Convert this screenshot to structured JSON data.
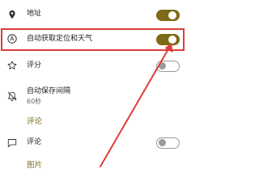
{
  "settings": {
    "address": {
      "label": "地址",
      "icon": "location-pin-icon",
      "enabled": true
    },
    "auto_location_weather": {
      "label": "自动获取定位和天气",
      "icon": "circle-a-icon",
      "enabled": true
    },
    "rating": {
      "label": "评分",
      "icon": "star-icon",
      "enabled": false
    },
    "autosave_interval": {
      "label": "自动保存间隔",
      "value": "60秒",
      "icon": "bell-timer-icon"
    },
    "comments_section": {
      "title": "评论"
    },
    "comment": {
      "label": "评论",
      "icon": "comment-box-icon",
      "enabled": false
    },
    "images_section": {
      "title": "图片"
    }
  },
  "annotation": {
    "highlight_color": "#e03a3a",
    "arrow_color": "#e03a3a"
  },
  "colors": {
    "accent": "#7c6a16",
    "section_title": "#7a6d1f"
  }
}
